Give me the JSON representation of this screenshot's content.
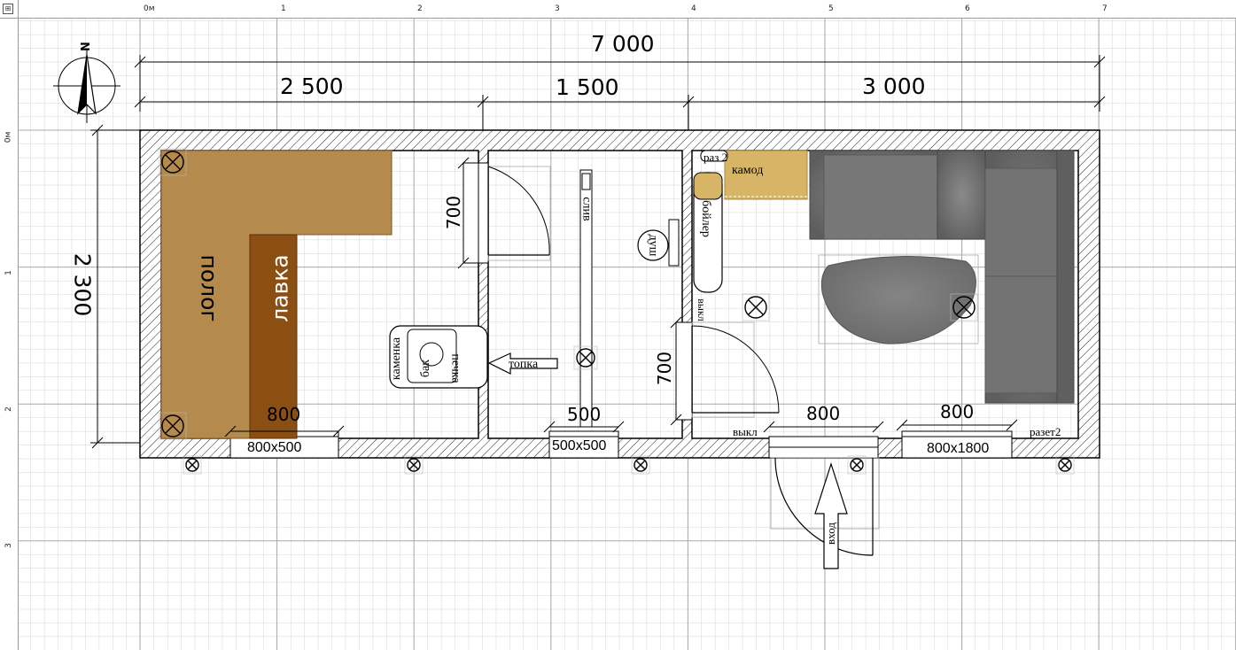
{
  "rulers": {
    "top_ticks": [
      "0м",
      "1",
      "2",
      "3",
      "4",
      "5",
      "6",
      "7"
    ],
    "left_ticks": [
      "0м",
      "1",
      "2",
      "3"
    ],
    "corner_icon": "grid-toggle-icon"
  },
  "compass": {
    "north_label": "N",
    "icon": "compass-icon"
  },
  "dimensions": {
    "total_width": "7 000",
    "section_1": "2 500",
    "section_2": "1 500",
    "section_3": "3 000",
    "height": "2 300",
    "door_left": "700",
    "door_right": "700",
    "win_1_width": "800",
    "win_2_width": "500",
    "door_entry_width": "800",
    "win_3_width": "800"
  },
  "openings": {
    "window_1": "800x500",
    "window_2": "500x500",
    "window_3": "800x1800"
  },
  "labels": {
    "polok": "полог",
    "lavka": "лавка",
    "kamenka": "каменка",
    "bak": "бак",
    "pechka": "печка",
    "topka": "топка",
    "sliv": "слив",
    "dush": "душ",
    "boiler": "бойлер",
    "raz2_top": "раз 2",
    "kamod": "камод",
    "vykl_vertical": "выкл",
    "vykl": "выкл",
    "razet2": "разет2",
    "vhod": "вход"
  },
  "colors": {
    "polok_fill": "#b58a4d",
    "lavka_fill": "#8c4f13",
    "kamod_fill": "#d8b566",
    "sofa_fill": "#6d6d6d",
    "grid_minor": "#d4d4d4",
    "grid_major": "#a8a8a8",
    "wall_hatch": "#222222"
  }
}
